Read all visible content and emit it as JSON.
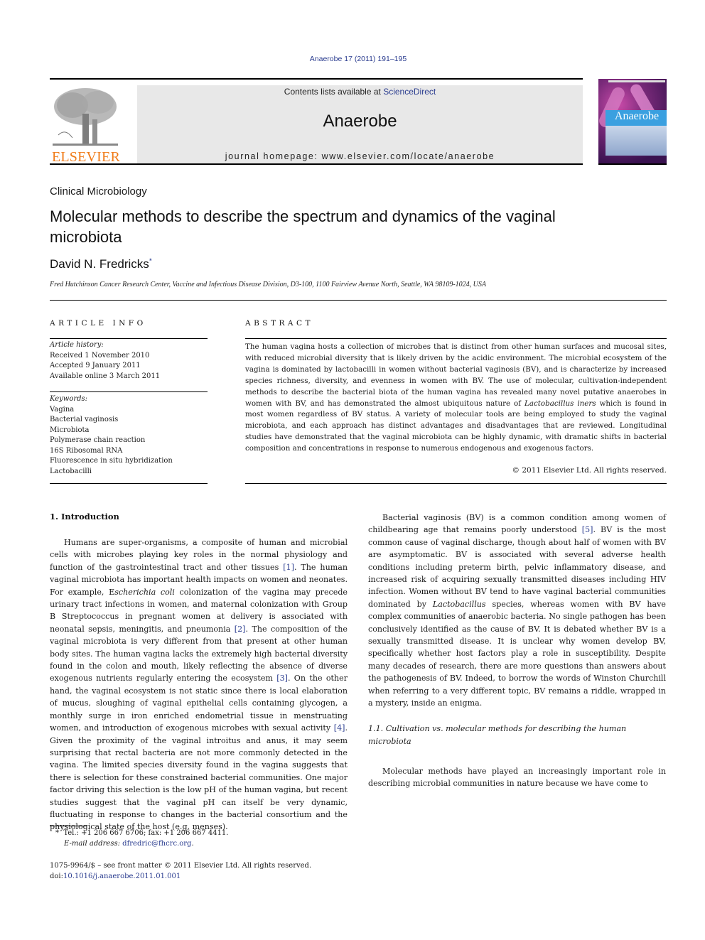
{
  "header": {
    "citation": "Anaerobe 17 (2011) 191–195",
    "contents_prefix": "Contents lists available at ",
    "contents_link": "ScienceDirect",
    "journal_name": "Anaerobe",
    "homepage": "journal homepage: www.elsevier.com/locate/anaerobe",
    "publisher_logo_text": "ELSEVIER",
    "publisher_logo_icon": "elsevier-tree-icon",
    "cover_title": "Anaerobe",
    "colors": {
      "link": "#2a3c8f",
      "elsevier_orange": "#f07c1a",
      "masthead_bg": "#e8e8e8"
    }
  },
  "article": {
    "section": "Clinical Microbiology",
    "title": "Molecular methods to describe the spectrum and dynamics of the vaginal microbiota",
    "author": "David N. Fredricks",
    "author_marker": "*",
    "affiliation": "Fred Hutchinson Cancer Research Center, Vaccine and Infectious Disease Division, D3-100, 1100 Fairview Avenue North, Seattle, WA 98109-1024, USA"
  },
  "article_info": {
    "heading": "ARTICLE INFO",
    "history_label": "Article history:",
    "history": [
      "Received 1 November 2010",
      "Accepted 9 January 2011",
      "Available online 3 March 2011"
    ],
    "keywords_label": "Keywords:",
    "keywords": [
      "Vagina",
      "Bacterial vaginosis",
      "Microbiota",
      "Polymerase chain reaction",
      "16S Ribosomal RNA",
      "Fluorescence in situ hybridization",
      "Lactobacilli"
    ]
  },
  "abstract": {
    "heading": "ABSTRACT",
    "text_1": "The human vagina hosts a collection of microbes that is distinct from other human surfaces and mucosal sites, with reduced microbial diversity that is likely driven by the acidic environment. The microbial ecosystem of the vagina is dominated by lactobacilli in women without bacterial vaginosis (BV), and is characterize by increased species richness, diversity, and evenness in women with BV. The use of molecular, cultivation-independent methods to describe the bacterial biota of the human vagina has revealed many novel putative anaerobes in women with BV, and has demonstrated the almost ubiquitous nature of ",
    "text_italic": "Lactobacillus iners",
    "text_2": " which is found in most women regardless of BV status. A variety of molecular tools are being employed to study the vaginal microbiota, and each approach has distinct advantages and disadvantages that are reviewed. Longitudinal studies have demonstrated that the vaginal microbiota can be highly dynamic, with dramatic shifts in bacterial composition and concentrations in response to numerous endogenous and exogenous factors.",
    "copyright": "© 2011 Elsevier Ltd. All rights reserved."
  },
  "body": {
    "intro_heading": "1.  Introduction",
    "p1": [
      "Humans are super-organisms, a composite of human and microbial cells with microbes playing key roles in the normal physiology and function of the gastrointestinal tract and other tissues ",
      "[1]",
      ". The human vaginal microbiota has important health impacts on women and neonates. For example, E",
      "scherichia coli",
      " colonization of the vagina may precede urinary tract infections in women, and maternal colonization with Group B Streptococcus in pregnant women at delivery is associated with neonatal sepsis, meningitis, and pneumonia ",
      "[2]",
      ". The composition of the vaginal microbiota is very different from that present at other human body sites. The human vagina lacks the extremely high bacterial diversity found in the colon and mouth, likely reflecting the absence of diverse exogenous nutrients regularly entering the ecosystem ",
      "[3]",
      ". On the other hand, the vaginal ecosystem is not static since there is local elaboration of mucus, sloughing of vaginal epithelial cells containing glycogen, a monthly surge in iron enriched endometrial tissue in menstruating women, and introduction of exogenous microbes with sexual activity ",
      "[4]",
      ". Given the proximity of the vaginal introitus and anus, it may seem surprising that rectal bacteria are not more commonly detected in the vagina. The limited species diversity found in the vagina suggests that there is selection for these constrained bacterial communities. One major factor driving this selection is the low pH of the human vagina, but recent studies suggest that the vaginal pH can itself be very dynamic, fluctuating in response to changes in the bacterial consortium and the physiological state of the host (e.g. menses)."
    ],
    "p2": [
      "Bacterial vaginosis (BV) is a common condition among women of childbearing age that remains poorly understood ",
      "[5]",
      ". BV is the most common cause of vaginal discharge, though about half of women with BV are asymptomatic. BV is associated with several adverse health conditions including preterm birth, pelvic inflammatory disease, and increased risk of acquiring sexually transmitted diseases including HIV infection. Women without BV tend to have vaginal bacterial communities dominated by ",
      "Lactobacillus",
      " species, whereas women with BV have complex communities of anaerobic bacteria. No single pathogen has been conclusively identified as the cause of BV. It is debated whether BV is a sexually transmitted disease. It is unclear why women develop BV, specifically whether host factors play a role in susceptibility. Despite many decades of research, there are more questions than answers about the pathogenesis of BV. Indeed, to borrow the words of Winston Churchill when referring to a very different topic, BV remains a riddle, wrapped in a mystery, inside an enigma."
    ],
    "subsection_heading": "1.1.  Cultivation vs. molecular methods for describing the human microbiota",
    "p3": "Molecular methods have played an increasingly important role in describing microbial communities in nature because we have come to"
  },
  "footnote": {
    "marker": "*",
    "contact": "Tel.: +1 206 667 6706; fax: +1 206 667 4411.",
    "email_label": "E-mail address:",
    "email": "dfredric@fhcrc.org",
    "email_suffix": "."
  },
  "front_matter": {
    "issn_line": "1075-9964/$ – see front matter © 2011 Elsevier Ltd. All rights reserved.",
    "doi_label": "doi:",
    "doi": "10.1016/j.anaerobe.2011.01.001"
  }
}
